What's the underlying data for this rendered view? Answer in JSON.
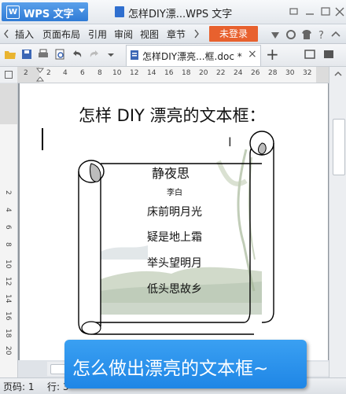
{
  "app": {
    "name": "WPS 文字",
    "logo_letter": "W",
    "window_title": "怎样DIY漂...WPS 文字"
  },
  "menu": {
    "items": [
      "插入",
      "页面布局",
      "引用",
      "审阅",
      "视图",
      "章节"
    ],
    "login_label": "未登录"
  },
  "tab": {
    "doc_name": "怎样DIY漂亮...框.doc *",
    "close_glyph": "×",
    "add_glyph": "+"
  },
  "ruler": {
    "h_ticks": [
      "2",
      "2",
      "4",
      "6",
      "8",
      "10",
      "12",
      "14",
      "16",
      "18",
      "20",
      "22",
      "24",
      "26",
      "28",
      "30",
      "32"
    ],
    "v_ticks": [
      "2",
      "4",
      "6",
      "8",
      "10",
      "12",
      "14",
      "16",
      "18",
      "20"
    ]
  },
  "document": {
    "heading": "怎样 DIY 漂亮的文本框：",
    "poem": {
      "title": "静夜思",
      "author": "李白",
      "lines": [
        "床前明月光",
        "疑是地上霜",
        "举头望明月",
        "低头思故乡"
      ]
    }
  },
  "status": {
    "page": "页码: 1",
    "line": "行: 3"
  },
  "banner": {
    "text": "怎么做出漂亮的文本框~"
  },
  "colors": {
    "accent_blue": "#2f7bd6",
    "login_orange": "#e8612e",
    "banner_blue": "#1f86e6"
  }
}
